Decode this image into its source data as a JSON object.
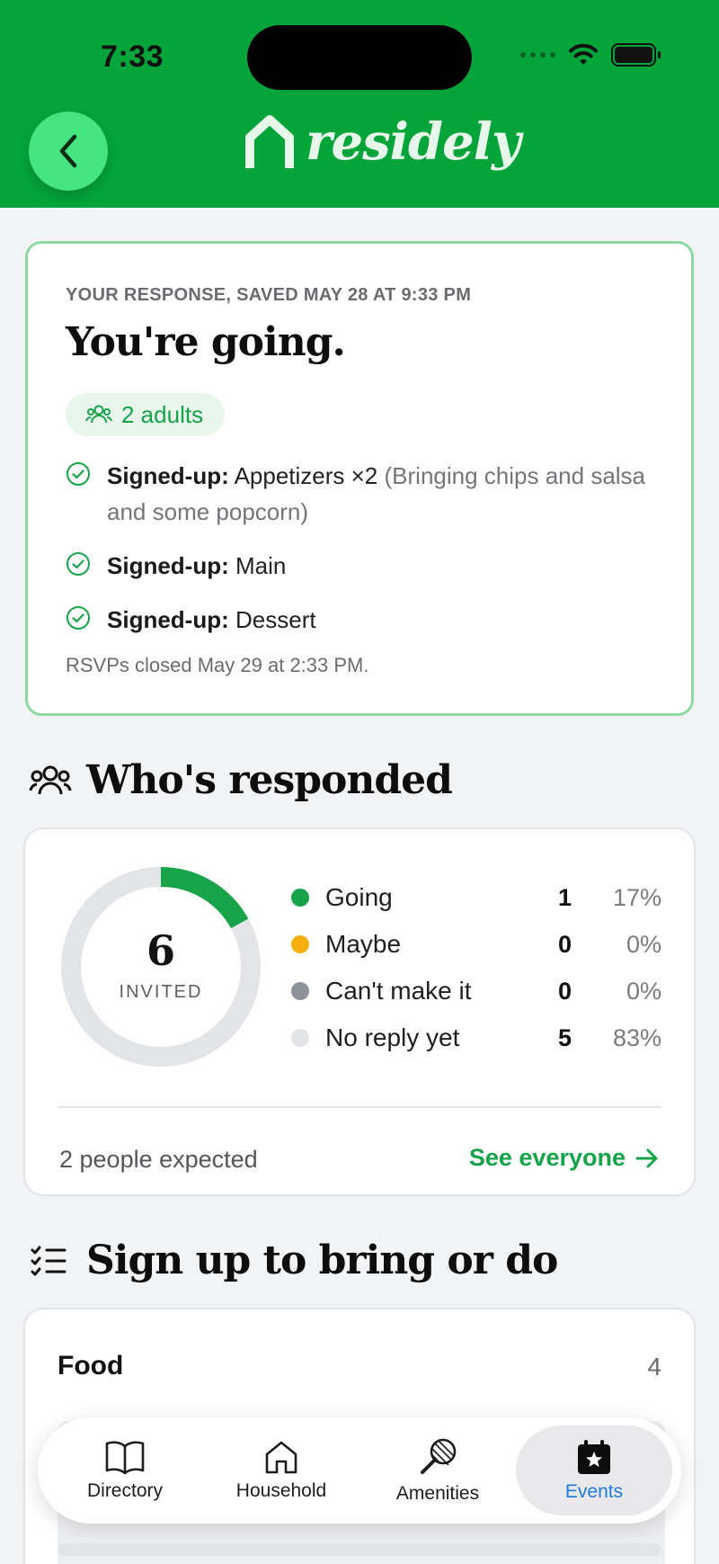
{
  "status_bar": {
    "time": "7:33"
  },
  "header": {
    "logo_text": "residely",
    "back_icon": "chevron-left-icon",
    "bg_color": "#03a53a"
  },
  "response": {
    "eyebrow": "YOUR RESPONSE, SAVED MAY 28 AT 9:33 PM",
    "title": "You're going.",
    "party": "2 adults",
    "signups": [
      {
        "prefix": "Signed-up:",
        "item": "Appetizers ×2",
        "note": "(Bringing chips and salsa and some popcorn)"
      },
      {
        "prefix": "Signed-up:",
        "item": "Main",
        "note": ""
      },
      {
        "prefix": "Signed-up:",
        "item": "Dessert",
        "note": ""
      }
    ],
    "closed_text": "RSVPs closed May 29 at 2:33 PM."
  },
  "responded": {
    "title": "Who's responded",
    "total": "6",
    "total_label": "INVITED",
    "rows": [
      {
        "label": "Going",
        "count": "1",
        "pct": "17%",
        "color": "#16a34a",
        "fraction": 0.17
      },
      {
        "label": "Maybe",
        "count": "0",
        "pct": "0%",
        "color": "#f5b00f",
        "fraction": 0
      },
      {
        "label": "Can't make it",
        "count": "0",
        "pct": "0%",
        "color": "#8e929b",
        "fraction": 0
      },
      {
        "label": "No reply yet",
        "count": "5",
        "pct": "83%",
        "color": "#e3e4e7",
        "fraction": 0.83
      }
    ],
    "expected": "2 people expected",
    "see_everyone": "See everyone"
  },
  "signup_section": {
    "title": "Sign up to bring or do",
    "categories": [
      {
        "name": "Food",
        "count": "4"
      }
    ]
  },
  "tabbar": {
    "tabs": [
      {
        "label": "Directory",
        "icon": "book-icon",
        "active": false
      },
      {
        "label": "Household",
        "icon": "house-icon",
        "active": false
      },
      {
        "label": "Amenities",
        "icon": "racket-icon",
        "active": false
      },
      {
        "label": "Events",
        "icon": "calendar-star-icon",
        "active": true
      }
    ],
    "active_color": "#1f7ae0"
  }
}
